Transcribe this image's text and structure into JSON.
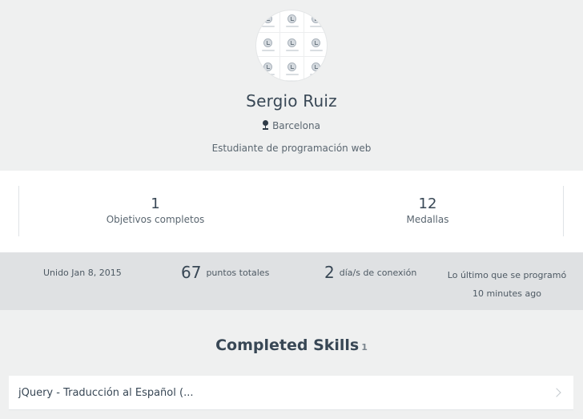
{
  "profile": {
    "name": "Sergio Ruiz",
    "location": "Barcelona",
    "bio": "Estudiante de programación web",
    "avatar_icon": "badges-grid-icon"
  },
  "stats": {
    "goals_value": "1",
    "goals_label": "Objetivos completos",
    "medals_value": "12",
    "medals_label": "Medallas"
  },
  "activity": {
    "joined": "Unido Jan 8, 2015",
    "points_value": "67",
    "points_label": "puntos totales",
    "days_value": "2",
    "days_label": "día/s de conexión",
    "last_coded": "Lo último que se programó 10 minutes ago"
  },
  "skills": {
    "title": "Completed Skills",
    "count": "1",
    "items": [
      {
        "label": "jQuery - Traducción al Español (...",
        "icon": "chevron-right-icon"
      }
    ]
  },
  "colors": {
    "page_bg": "#eff0f0",
    "card_bg": "#ffffff",
    "activity_bg": "#dfe1e3",
    "text_primary": "#384755",
    "text_secondary": "#5a6670"
  }
}
